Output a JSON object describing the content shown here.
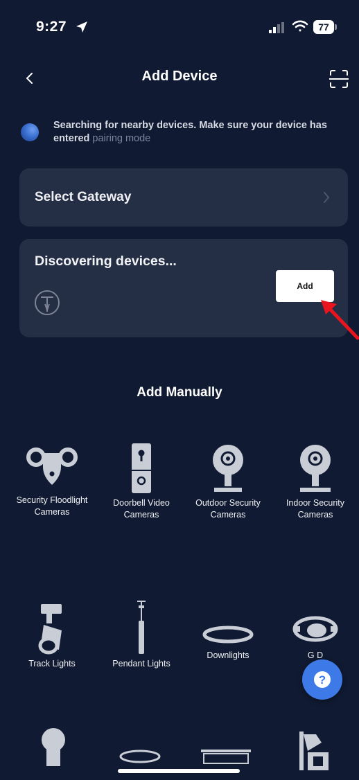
{
  "status_bar": {
    "time": "9:27",
    "battery": "77",
    "icons": [
      "location-arrow-icon",
      "cellular-signal-icon",
      "wifi-icon",
      "battery-icon"
    ]
  },
  "header": {
    "title": "Add Device",
    "back_icon": "chevron-left-icon",
    "scan_icon": "scan-icon"
  },
  "searching": {
    "text": "Searching for nearby devices. Make sure your device has entered",
    "link": "pairing mode"
  },
  "gateway": {
    "label": "Select Gateway",
    "icon": "chevron-right-icon"
  },
  "discover": {
    "title": "Discovering devices...",
    "add_label": "Add",
    "device_icon": "pendant-lamp-icon"
  },
  "manual": {
    "title": "Add Manually",
    "devices": [
      {
        "label": "Security Floodlight Cameras",
        "icon": "floodlight-camera-icon"
      },
      {
        "label": "Doorbell Video Cameras",
        "icon": "doorbell-camera-icon"
      },
      {
        "label": "Outdoor Security Cameras",
        "icon": "outdoor-camera-icon"
      },
      {
        "label": "Indoor Security Cameras",
        "icon": "indoor-camera-icon"
      },
      {
        "label": "Track Lights",
        "icon": "track-light-icon"
      },
      {
        "label": "Pendant Lights",
        "icon": "pendant-light-icon"
      },
      {
        "label": "Downlights",
        "icon": "downlight-icon"
      },
      {
        "label": "G D",
        "icon": "gimbal-downlight-icon"
      }
    ]
  },
  "help": {
    "icon": "help-chat-icon"
  },
  "colors": {
    "background": "#101a32",
    "card": "#242e44",
    "accent": "#3d7ae8",
    "annotation_arrow": "#e8141e"
  }
}
